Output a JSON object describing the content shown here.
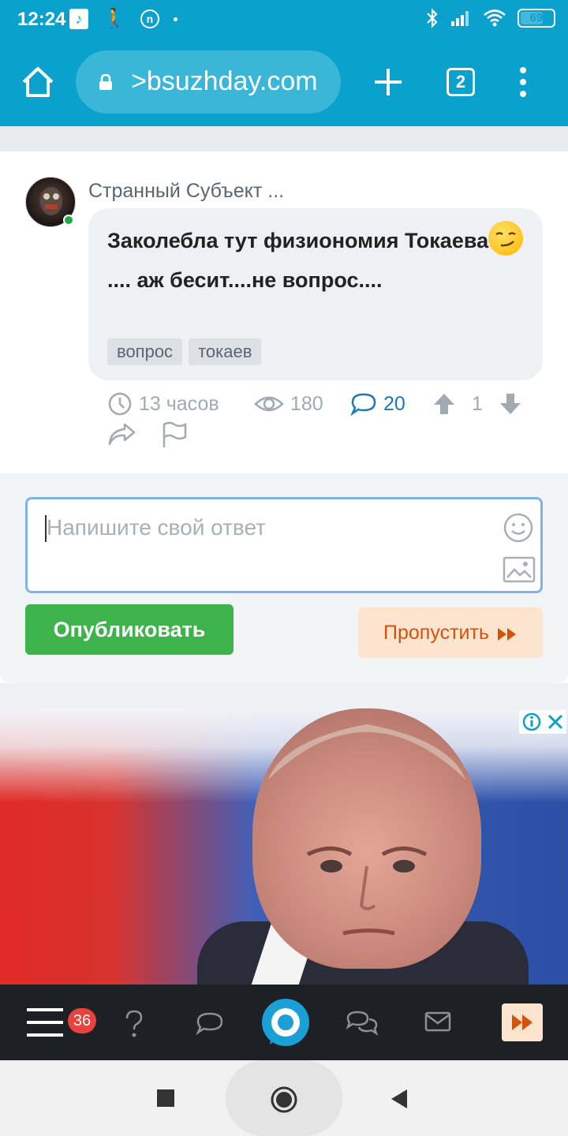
{
  "status": {
    "time": "12:24",
    "battery": "69",
    "battery_fraction": 0.69,
    "icons_left": [
      "music-app-icon",
      "walker-icon",
      "n-circle-icon",
      "dot-icon"
    ],
    "icons_right": [
      "bluetooth-icon",
      "signal-icon",
      "wifi-icon",
      "battery-icon"
    ]
  },
  "browser": {
    "url": ">bsuzhday.com",
    "tab_count": "2"
  },
  "post": {
    "author": "Странный Субъект ...",
    "text_before_emoji": "Заколебла тут физиономия Токаева",
    "text_after_emoji": ".... аж бесит....не вопрос....",
    "tags": [
      "вопрос",
      "токаев"
    ],
    "time_ago": "13 часов",
    "views": "180",
    "comments": "20",
    "votes": "1"
  },
  "reply": {
    "placeholder": "Напишите свой ответ",
    "publish_label": "Опубликовать",
    "skip_label": "Пропустить"
  },
  "bottom_nav": {
    "badge_count": "36"
  },
  "colors": {
    "brand_blue": "#0aa1cc",
    "publish_green": "#3cb44b",
    "skip_orange": "#d8510b",
    "link_blue": "#1b79b8",
    "badge_red": "#e8423f"
  }
}
